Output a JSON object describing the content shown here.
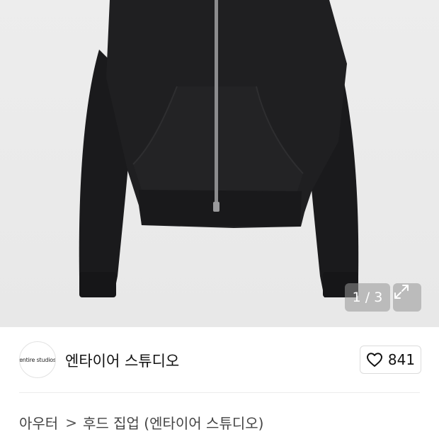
{
  "gallery": {
    "counter": "1 / 3",
    "image_alt": "black zip-up hoodie",
    "expand_icon": "expand-icon"
  },
  "brand": {
    "logo_text": "entire studios",
    "name": "엔타이어 스튜디오"
  },
  "like": {
    "icon": "heart-outline-icon",
    "count": "841"
  },
  "breadcrumb": {
    "category": "아우터",
    "separator": ">",
    "subcategory": "후드 집업 (엔타이어 스튜디오)"
  },
  "colors": {
    "image_bg": "#ebebeb",
    "garment": "#1c1c1e",
    "overlay": "rgba(150,150,150,0.55)"
  }
}
